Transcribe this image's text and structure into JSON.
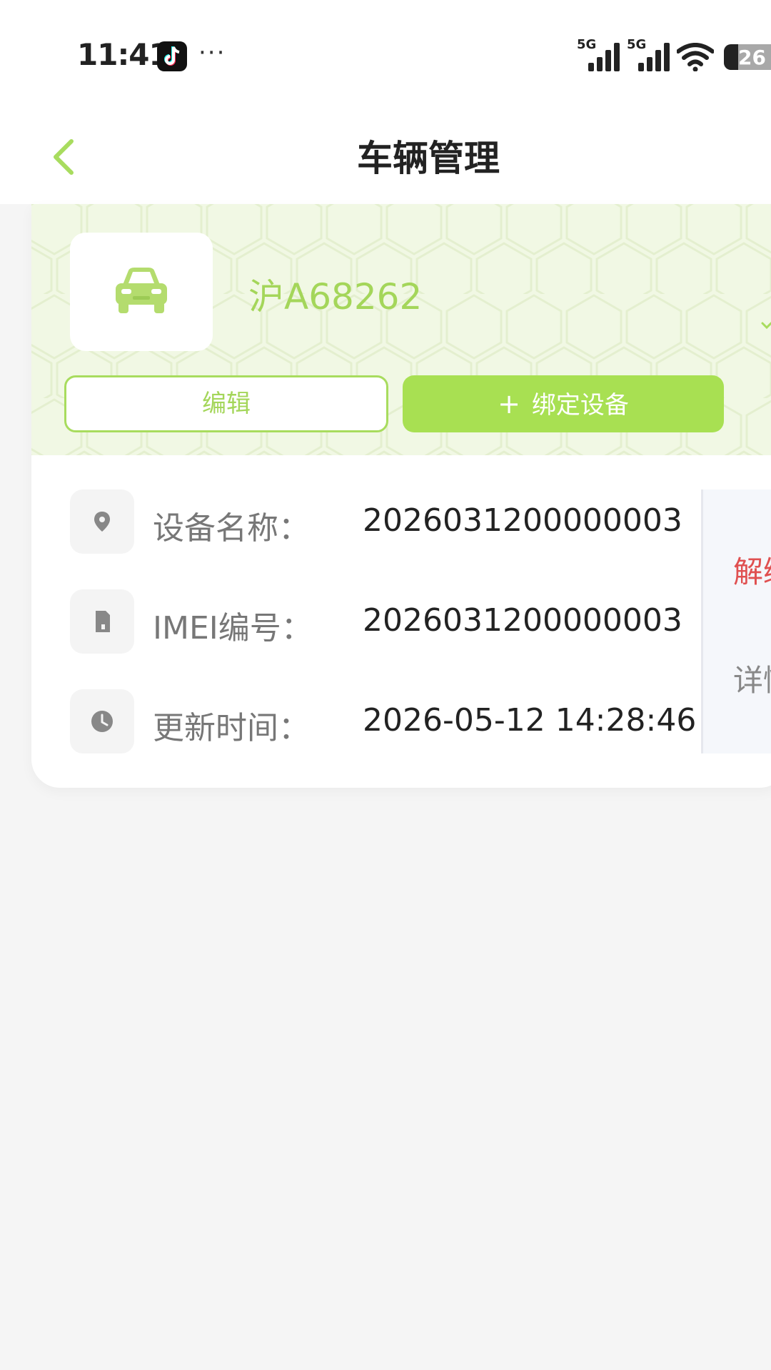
{
  "status_bar": {
    "time": "11:41",
    "overflow": "···",
    "signal_1_label": "5G",
    "signal_2_label": "5G",
    "battery_level": "26",
    "icons": [
      "tiktok-icon",
      "signal-icon",
      "wifi-icon",
      "battery-icon"
    ]
  },
  "navbar": {
    "title": "车辆管理",
    "back_icon": "chevron-left-icon"
  },
  "vehicle": {
    "plate": "沪A68262",
    "edit_label": "编辑",
    "bind_plus": "+",
    "bind_label": "绑定设备"
  },
  "device_info": [
    {
      "icon": "location-pin-icon",
      "label": "设备名称：",
      "value": "2026031200000003"
    },
    {
      "icon": "sim-card-icon",
      "label": "IMEI编号：",
      "value": "2026031200000003"
    },
    {
      "icon": "clock-icon",
      "label": "更新时间：",
      "value": "2026-05-12 14:28:46"
    }
  ],
  "side_actions": {
    "unbind_label": "解绑",
    "detail_label": "详情"
  },
  "colors": {
    "accent": "#a8e052",
    "accent_text": "#a4d65a",
    "danger": "#e05050",
    "header_bg": "#f1f8e4"
  }
}
